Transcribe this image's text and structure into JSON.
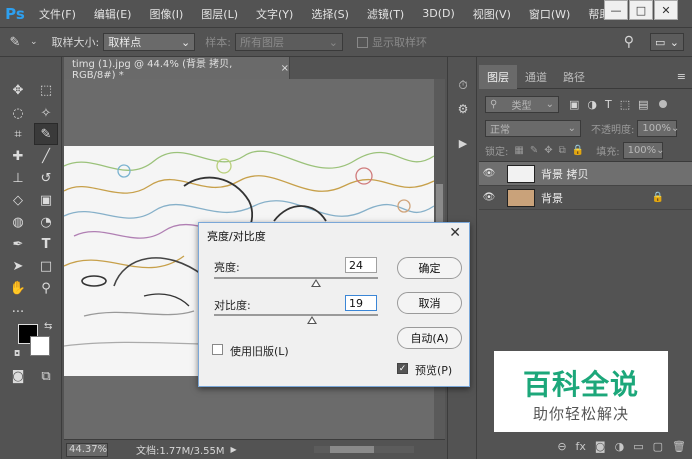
{
  "menubar": {
    "logo": "Ps",
    "items": [
      "文件(F)",
      "编辑(E)",
      "图像(I)",
      "图层(L)",
      "文字(Y)",
      "选择(S)",
      "滤镜(T)",
      "3D(D)",
      "视图(V)",
      "窗口(W)",
      "帮助(H)"
    ],
    "window_controls": [
      "—",
      "□",
      "✕"
    ]
  },
  "options": {
    "sample_size_label": "取样大小:",
    "sample_size_value": "取样点",
    "sample_label": "样本:",
    "sample_value": "所有图层",
    "show_ring_label": "显示取样环"
  },
  "document": {
    "tab_title": "timg (1).jpg @ 44.4% (背景 拷贝, RGB/8#) *",
    "tab_close": "×",
    "zoom": "44.37%",
    "doc_info": "文档:1.77M/3.55M"
  },
  "layers": {
    "tabs": [
      "图层",
      "通道",
      "路径"
    ],
    "filter_kind": "类型",
    "blend_mode": "正常",
    "opacity_label": "不透明度:",
    "opacity_value": "100%",
    "lock_label": "锁定:",
    "fill_label": "填充:",
    "fill_value": "100%",
    "items": [
      {
        "name": "背景 拷贝",
        "visible": true,
        "selected": true
      },
      {
        "name": "背景",
        "visible": true,
        "selected": false
      }
    ]
  },
  "dialog": {
    "title": "亮度/对比度",
    "brightness_label": "亮度:",
    "brightness_value": "24",
    "brightness_level": 0.62,
    "contrast_label": "对比度:",
    "contrast_value": "19",
    "contrast_level": 0.6,
    "ok": "确定",
    "cancel": "取消",
    "auto": "自动(A)",
    "use_legacy": "使用旧版(L)",
    "preview": "预览(P)"
  },
  "watermark": {
    "title": "百科全说",
    "subtitle": "助你轻松解决"
  },
  "colors": {
    "accent_blue": "#2da0f0",
    "watermark_green": "#1ca77a",
    "ui_gray": "#535353"
  }
}
